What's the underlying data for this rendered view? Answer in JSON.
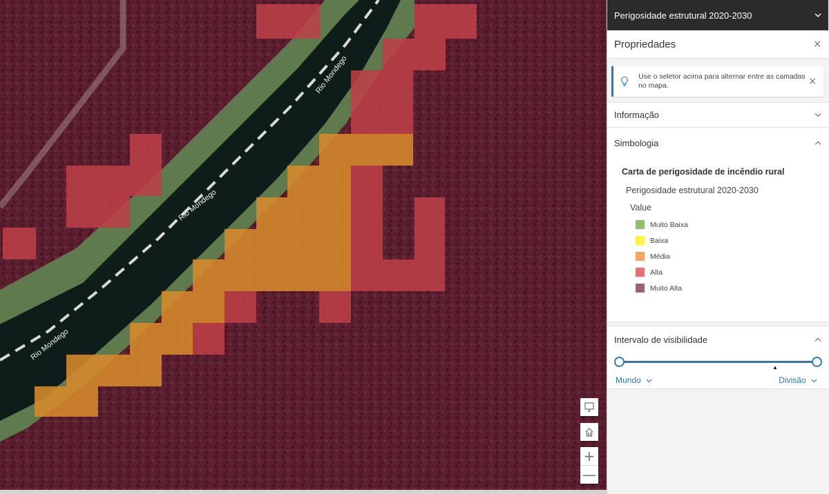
{
  "map": {
    "river_labels": [
      "Rio Mondego",
      "Rio Mondego",
      "Rio Mondego"
    ],
    "controls": {
      "legend_icon": "monitor-icon",
      "home_icon": "home-icon",
      "zoom_in": "+",
      "zoom_out": "—"
    }
  },
  "panel": {
    "layer_selector": {
      "title": "Perigosidade estrutural 2020-2030",
      "icon": "chevron-down-icon"
    },
    "properties": {
      "title": "Propriedades",
      "close": "×"
    },
    "notice": {
      "message": "Use o seletor acima para alternar entre as camadas no mapa.",
      "icon": "lightbulb-icon",
      "close": "×"
    },
    "sections": {
      "info": {
        "title": "Informação",
        "icon": "chevron-down-icon"
      },
      "symbology": {
        "title": "Simbologia",
        "icon": "chevron-up-icon"
      },
      "visibility": {
        "title": "Intervalo de visibilidade",
        "icon": "chevron-up-icon"
      }
    },
    "legend": {
      "layer": "Carta de perigosidade de incêndio rural",
      "sublayer": "Perigosidade estrutural 2020-2030",
      "field": "Value",
      "items": [
        {
          "label": "Muito Baixa",
          "color": "#8fbe6f"
        },
        {
          "label": "Baixa",
          "color": "#fff34a"
        },
        {
          "label": "Média",
          "color": "#f6a55a"
        },
        {
          "label": "Alta",
          "color": "#e5707a"
        },
        {
          "label": "Muito Alta",
          "color": "#9c6471"
        }
      ]
    },
    "visibility_range": {
      "min_label": "Mundo",
      "max_label": "Divisão",
      "accent": "#2a7ab8"
    }
  },
  "colors": {
    "muito_alta_overlay": "#5e1a2b",
    "alta_overlay": "#c04048",
    "media_overlay": "#d88a2c",
    "river": "#0e1c1a"
  }
}
